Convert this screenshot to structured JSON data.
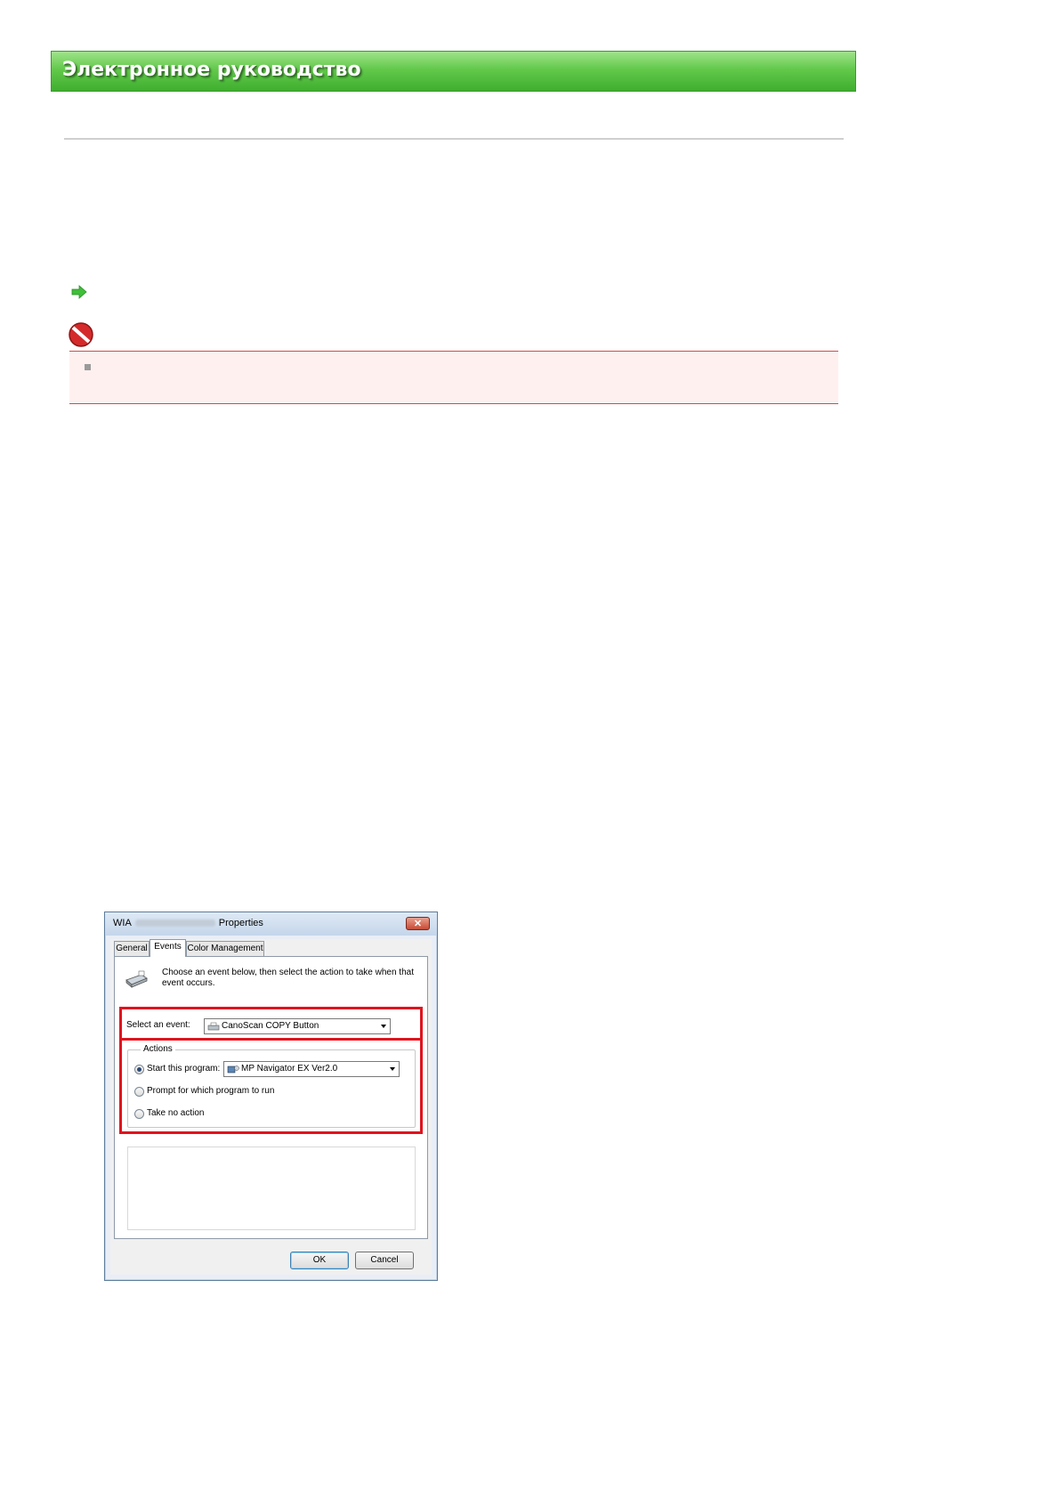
{
  "header": {
    "title": "Электронное руководство"
  },
  "dialog": {
    "title_prefix": "WIA",
    "title_suffix": "Properties",
    "close_glyph": "✕",
    "tabs": [
      "General",
      "Events",
      "Color Management"
    ],
    "active_tab": "Events",
    "description": "Choose an event below, then select the action to take when that event occurs.",
    "select_event_label": "Select an event:",
    "select_event_value": "CanoScan COPY Button",
    "actions_label": "Actions",
    "start_program_label": "Start this program:",
    "start_program_value": "MP Navigator EX Ver2.0",
    "prompt_label": "Prompt for which program to run",
    "no_action_label": "Take no action",
    "selected_action": "start_program",
    "ok_label": "OK",
    "cancel_label": "Cancel"
  },
  "colors": {
    "banner_green": "#62c94b",
    "highlight_red": "#e0141e",
    "important_bg": "#fff0f0",
    "important_border": "#d24a4a"
  },
  "icons": [
    "green-arrow-icon",
    "stop-icon",
    "scanner-icon",
    "close-icon",
    "dropdown-arrow-icon"
  ]
}
